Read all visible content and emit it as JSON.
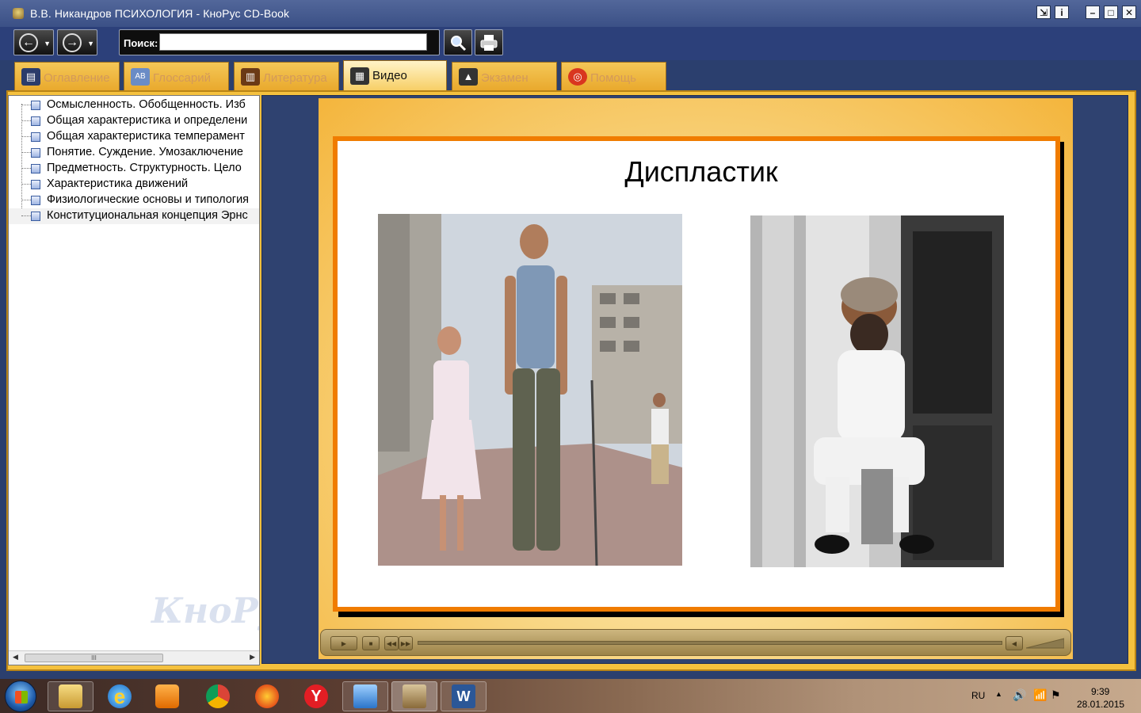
{
  "window": {
    "title": "В.В. Никандров ПСИХОЛОГИЯ - КноРус CD-Book",
    "buttons": {
      "help": "i",
      "minimize": "–",
      "maximize": "□",
      "close": "✕"
    }
  },
  "toolbar": {
    "back_icon": "←",
    "forward_icon": "→",
    "search_label": "Поиск:",
    "search_value": "",
    "search_button_icon": "search-icon",
    "print_button_icon": "print-icon"
  },
  "tabs": [
    {
      "label": "Оглавление",
      "icon": "book-icon",
      "active": false
    },
    {
      "label": "Глоссарий",
      "icon": "glossary-icon",
      "active": false
    },
    {
      "label": "Литература",
      "icon": "books-icon",
      "active": false
    },
    {
      "label": "Видео",
      "icon": "film-icon",
      "active": true
    },
    {
      "label": "Экзамен",
      "icon": "graduation-cap-icon",
      "active": false
    },
    {
      "label": "Помощь",
      "icon": "lifebuoy-icon",
      "active": false
    }
  ],
  "sidebar": {
    "items": [
      {
        "label": "Осмысленность. Обобщенность. Изб"
      },
      {
        "label": "Общая характеристика и определени"
      },
      {
        "label": "Общая характеристика темперамент"
      },
      {
        "label": "Понятие. Суждение. Умозаключение"
      },
      {
        "label": "Предметность. Структурность. Цело"
      },
      {
        "label": "Характеристика движений"
      },
      {
        "label": "Физиологические основы и типология"
      },
      {
        "label": "Конституциональная концепция Эрнс"
      }
    ],
    "watermark": "КноРус",
    "scroll_thumb": "III"
  },
  "slide": {
    "title": "Диспластик"
  },
  "player": {
    "play": "▶",
    "stop": "■",
    "rewind": "◀◀",
    "forward": "▶▶"
  },
  "taskbar": {
    "apps": [
      "explorer",
      "internet-explorer",
      "media-player",
      "chrome",
      "firefox",
      "yandex",
      "image-viewer",
      "knorus",
      "word"
    ],
    "language": "RU",
    "time": "9:39",
    "date": "28.01.2015"
  }
}
